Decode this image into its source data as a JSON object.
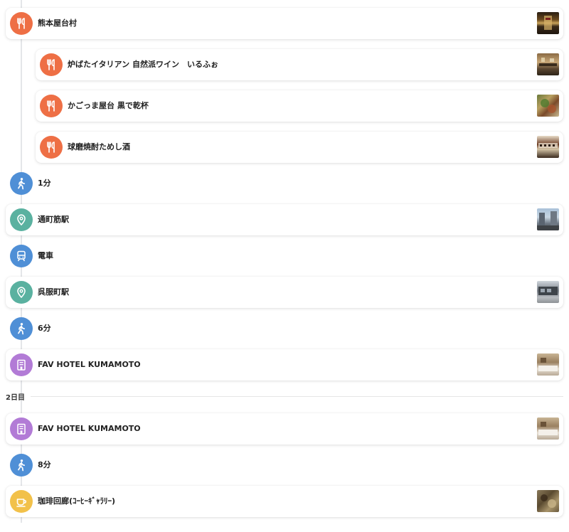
{
  "colors": {
    "food": "#ee6f45",
    "walk": "#4f8fd6",
    "place": "#5ab1a0",
    "train": "#4f8fd6",
    "hotel": "#b27bd6",
    "cafe": "#f2c14a"
  },
  "items": [
    {
      "kind": "spot",
      "icon": "restaurant-icon",
      "label": "熊本屋台村"
    },
    {
      "kind": "spot",
      "icon": "restaurant-icon",
      "label": "炉ばたイタリアン 自然派ワイン　いるふぉ"
    },
    {
      "kind": "spot",
      "icon": "restaurant-icon",
      "label": "かごっま屋台 黒で乾杯"
    },
    {
      "kind": "spot",
      "icon": "restaurant-icon",
      "label": "球磨焼酎ためし酒"
    },
    {
      "kind": "move",
      "icon": "walk-icon",
      "label": "1分"
    },
    {
      "kind": "spot",
      "icon": "location-pin-icon",
      "label": "通町筋駅"
    },
    {
      "kind": "move",
      "icon": "train-icon",
      "label": "電車"
    },
    {
      "kind": "spot",
      "icon": "location-pin-icon",
      "label": "呉服町駅"
    },
    {
      "kind": "move",
      "icon": "walk-icon",
      "label": "6分"
    },
    {
      "kind": "spot",
      "icon": "hotel-icon",
      "label": "FAV HOTEL KUMAMOTO"
    }
  ],
  "day2": {
    "header": "2日目",
    "items": [
      {
        "kind": "spot",
        "icon": "hotel-icon",
        "label": "FAV HOTEL KUMAMOTO"
      },
      {
        "kind": "move",
        "icon": "walk-icon",
        "label": "8分"
      },
      {
        "kind": "spot",
        "icon": "cafe-icon",
        "label": "珈琲回廊(ｺｰﾋｰｷﾞｬﾗﾘｰ)"
      }
    ]
  }
}
